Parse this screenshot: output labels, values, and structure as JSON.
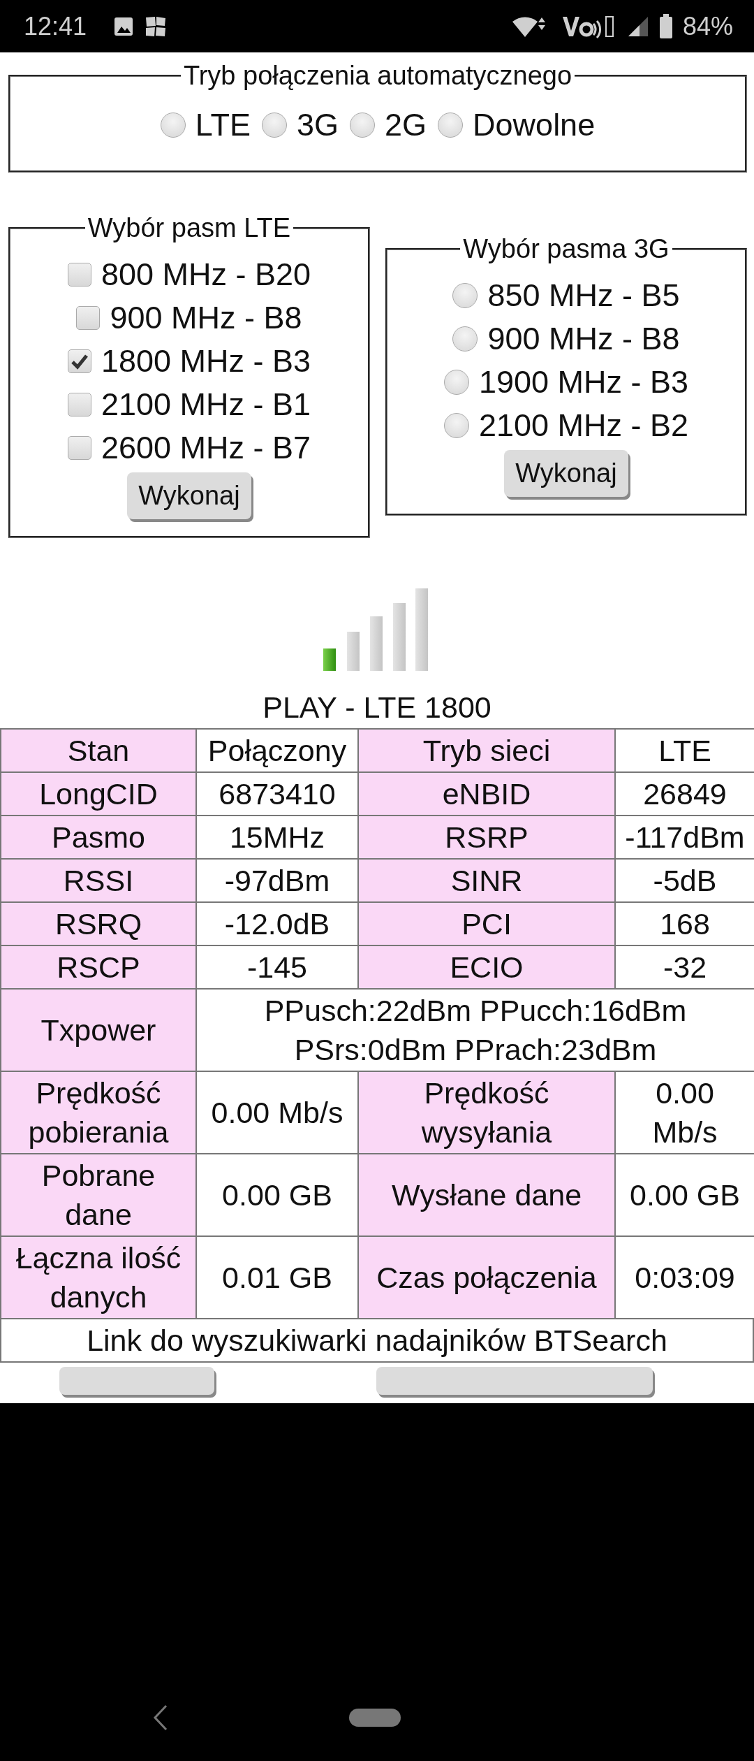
{
  "status_bar": {
    "time": "12:41",
    "battery": "84%"
  },
  "auto_mode": {
    "legend": "Tryb połączenia automatycznego",
    "options": [
      {
        "label": "LTE",
        "selected": false
      },
      {
        "label": "3G",
        "selected": false
      },
      {
        "label": "2G",
        "selected": false
      },
      {
        "label": "Dowolne",
        "selected": false
      }
    ]
  },
  "lte_bands": {
    "legend": "Wybór pasm LTE",
    "items": [
      {
        "label": "800 MHz - B20",
        "checked": false
      },
      {
        "label": "900 MHz - B8",
        "checked": false
      },
      {
        "label": "1800 MHz - B3",
        "checked": true
      },
      {
        "label": "2100 MHz - B1",
        "checked": false
      },
      {
        "label": "2600 MHz - B7",
        "checked": false
      }
    ],
    "button": "Wykonaj"
  },
  "umts_bands": {
    "legend": "Wybór pasma 3G",
    "options": [
      {
        "label": "850 MHz - B5",
        "selected": false
      },
      {
        "label": "900 MHz - B8",
        "selected": false
      },
      {
        "label": "1900 MHz - B3",
        "selected": false
      },
      {
        "label": "2100 MHz - B2",
        "selected": false
      }
    ],
    "button": "Wykonaj"
  },
  "network_title": "PLAY - LTE 1800",
  "table": {
    "rows": [
      {
        "cells": [
          {
            "kind": "label",
            "text": "Stan"
          },
          {
            "kind": "value",
            "text": "Połączony"
          },
          {
            "kind": "label",
            "text": "Tryb sieci"
          },
          {
            "kind": "value",
            "text": "LTE"
          }
        ]
      },
      {
        "cells": [
          {
            "kind": "label",
            "text": "LongCID"
          },
          {
            "kind": "value",
            "text": "6873410"
          },
          {
            "kind": "label",
            "text": "eNBID"
          },
          {
            "kind": "value",
            "text": "26849"
          }
        ]
      },
      {
        "cells": [
          {
            "kind": "label",
            "text": "Pasmo"
          },
          {
            "kind": "value",
            "text": "15MHz"
          },
          {
            "kind": "label",
            "text": "RSRP"
          },
          {
            "kind": "value",
            "text": "-117dBm"
          }
        ]
      },
      {
        "cells": [
          {
            "kind": "label",
            "text": "RSSI"
          },
          {
            "kind": "value",
            "text": "-97dBm"
          },
          {
            "kind": "label",
            "text": "SINR"
          },
          {
            "kind": "value",
            "text": "-5dB"
          }
        ]
      },
      {
        "cells": [
          {
            "kind": "label",
            "text": "RSRQ"
          },
          {
            "kind": "value",
            "text": "-12.0dB"
          },
          {
            "kind": "label",
            "text": "PCI"
          },
          {
            "kind": "value",
            "text": "168"
          }
        ]
      },
      {
        "cells": [
          {
            "kind": "label",
            "text": "RSCP"
          },
          {
            "kind": "value",
            "text": "-145"
          },
          {
            "kind": "label",
            "text": "ECIO"
          },
          {
            "kind": "value",
            "text": "-32"
          }
        ]
      },
      {
        "cells": [
          {
            "kind": "label",
            "text": "Txpower"
          },
          {
            "kind": "wide_value",
            "colspan": 3,
            "text": "PPusch:22dBm PPucch:16dBm\nPSrs:0dBm PPrach:23dBm"
          }
        ]
      },
      {
        "cells": [
          {
            "kind": "label",
            "text": "Prędkość pobierania"
          },
          {
            "kind": "value",
            "text": "0.00 Mb/s"
          },
          {
            "kind": "label",
            "text": "Prędkość wysyłania"
          },
          {
            "kind": "value",
            "text": "0.00 Mb/s"
          }
        ]
      },
      {
        "cells": [
          {
            "kind": "label",
            "text": "Pobrane dane"
          },
          {
            "kind": "value",
            "text": "0.00 GB"
          },
          {
            "kind": "label",
            "text": "Wysłane dane"
          },
          {
            "kind": "value",
            "text": "0.00 GB"
          }
        ]
      },
      {
        "cells": [
          {
            "kind": "label",
            "text": "Łączna ilość danych"
          },
          {
            "kind": "value",
            "text": "0.01 GB"
          },
          {
            "kind": "label",
            "text": "Czas połączenia"
          },
          {
            "kind": "value",
            "text": "0:03:09"
          }
        ]
      }
    ]
  },
  "link": "Link do wyszukiwarki nadajników BTSearch"
}
